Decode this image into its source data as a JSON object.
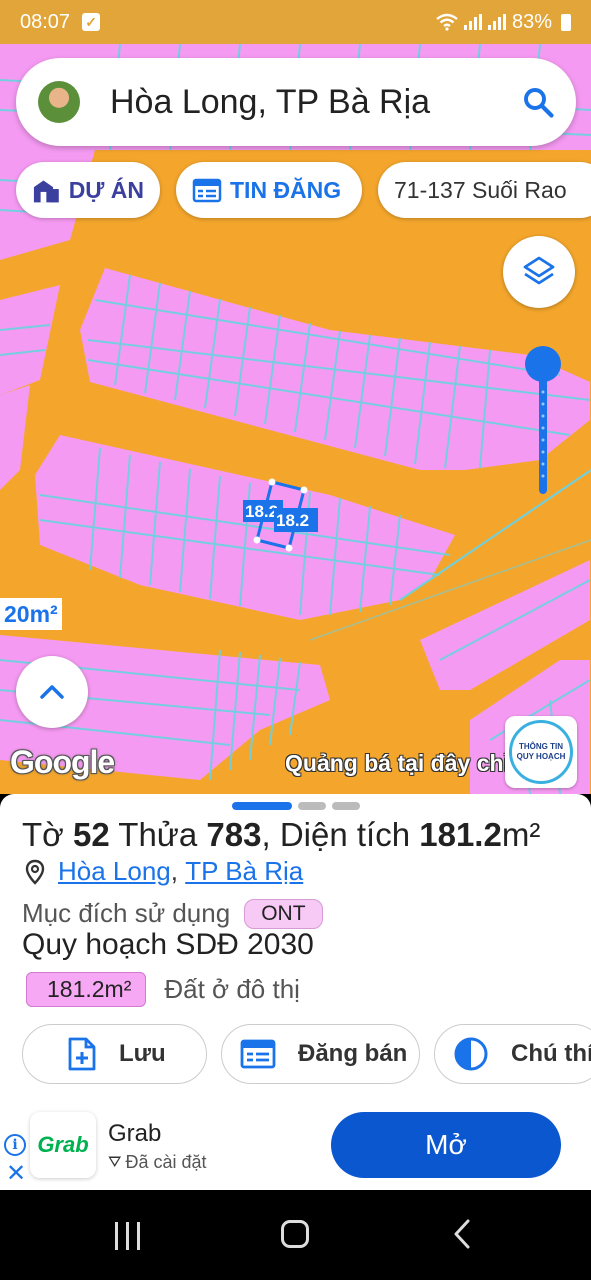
{
  "status_bar": {
    "time": "08:07",
    "battery": "83%"
  },
  "search": {
    "query": "Hòa Long, TP Bà Rịa"
  },
  "chips": {
    "du_an": "DỰ ÁN",
    "tin_dang": "TIN ĐĂNG",
    "address": "71-137 Suối Rao"
  },
  "map": {
    "parcel_label_1": "18.2",
    "parcel_label_2": "18.2",
    "area_label": "20m²",
    "google_logo": "Google",
    "promo_text": "Quảng bá tại đây chỉ",
    "badge_line1": "THÔNG TIN",
    "badge_line2": "QUY HOẠCH",
    "colors": {
      "residential": "#f59af2",
      "road": "#f4a62c",
      "parcel_line": "#6fd1e0",
      "selected": "#1a73e8"
    }
  },
  "parcel": {
    "to_label": "Tờ",
    "to_number": "52",
    "thua_label": "Thửa",
    "thua_number": "783",
    "area_label": "Diện tích",
    "area_value": "181.2",
    "area_unit": "m²",
    "ward": "Hòa Long",
    "city": "TP Bà Rịa",
    "purpose_label": "Mục đích sử dụng",
    "purpose_code": "ONT",
    "plan_title": "Quy hoạch SDĐ 2030",
    "plan_area": "181.2m²",
    "plan_desc": "Đất ở đô thị"
  },
  "actions": {
    "save": "Lưu",
    "sell": "Đăng bán",
    "legend": "Chú thích"
  },
  "ad": {
    "logo_text": "Grab",
    "app_name": "Grab",
    "installed": "Đã cài đặt",
    "open_button": "Mở"
  }
}
